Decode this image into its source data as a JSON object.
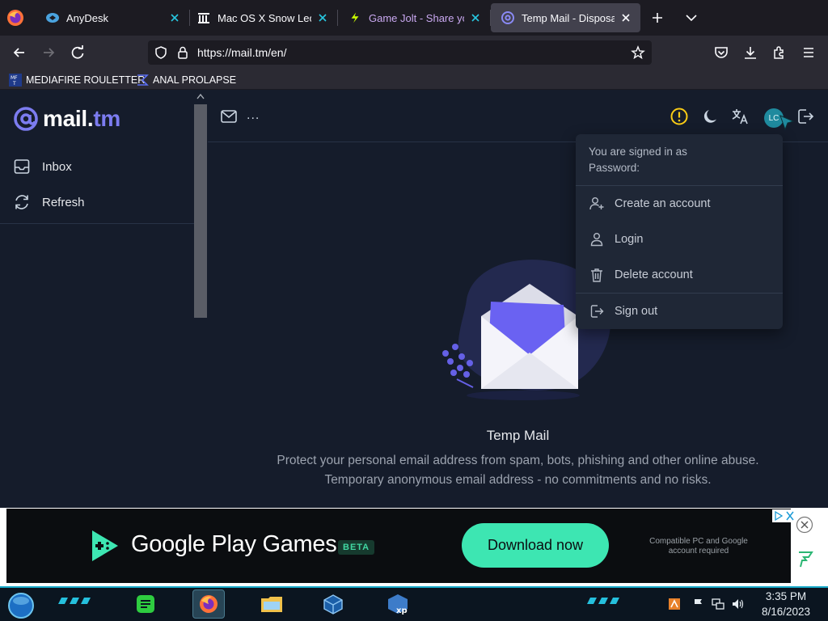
{
  "browser": {
    "tabs": [
      {
        "label": "AnyDesk",
        "icon": "anydesk-icon"
      },
      {
        "label": "Mac OS X Snow Leopard",
        "icon": "archive-icon"
      },
      {
        "label": "Game Jolt - Share your c",
        "icon": "gamejolt-icon"
      },
      {
        "label": "Temp Mail - Disposable",
        "icon": "mailtm-icon",
        "active": true
      }
    ],
    "url": "https://mail.tm/en/",
    "bookmarks": [
      {
        "label": "MEDIAFIRE ROULETTER",
        "icon": "mediafire-icon"
      },
      {
        "label": "ANAL PROLAPSE",
        "icon": "sigma-icon"
      }
    ]
  },
  "app": {
    "brand_main": "mail.",
    "brand_accent": "tm",
    "sidebar": {
      "items": [
        {
          "label": "Inbox",
          "icon": "inbox-icon"
        },
        {
          "label": "Refresh",
          "icon": "refresh-icon"
        }
      ]
    },
    "topbar": {
      "address_placeholder": "...",
      "avatar_initials": "LC"
    },
    "dropdown": {
      "signed_in_as": "You are signed in as",
      "password_label": "Password:",
      "items": [
        {
          "label": "Create an account",
          "icon": "user-plus-icon"
        },
        {
          "label": "Login",
          "icon": "user-icon"
        },
        {
          "label": "Delete account",
          "icon": "trash-icon"
        },
        {
          "label": "Sign out",
          "icon": "sign-out-icon"
        }
      ]
    },
    "empty_state": {
      "title": "Temp Mail",
      "line1": "Protect your personal email address from spam, bots, phishing and other online abuse.",
      "line2": "Temporary anonymous email address - no commitments and no risks."
    }
  },
  "ad": {
    "brand": "Google Play Games",
    "badge": "BETA",
    "cta": "Download now",
    "note": "Compatible PC and Google account required"
  },
  "taskbar": {
    "time": "3:35 PM",
    "date": "8/16/2023"
  },
  "colors": {
    "page_bg": "#151c2b",
    "accent": "#7c7cf0",
    "cta": "#3de6b2",
    "taskbar_accent": "#17a9c8"
  }
}
